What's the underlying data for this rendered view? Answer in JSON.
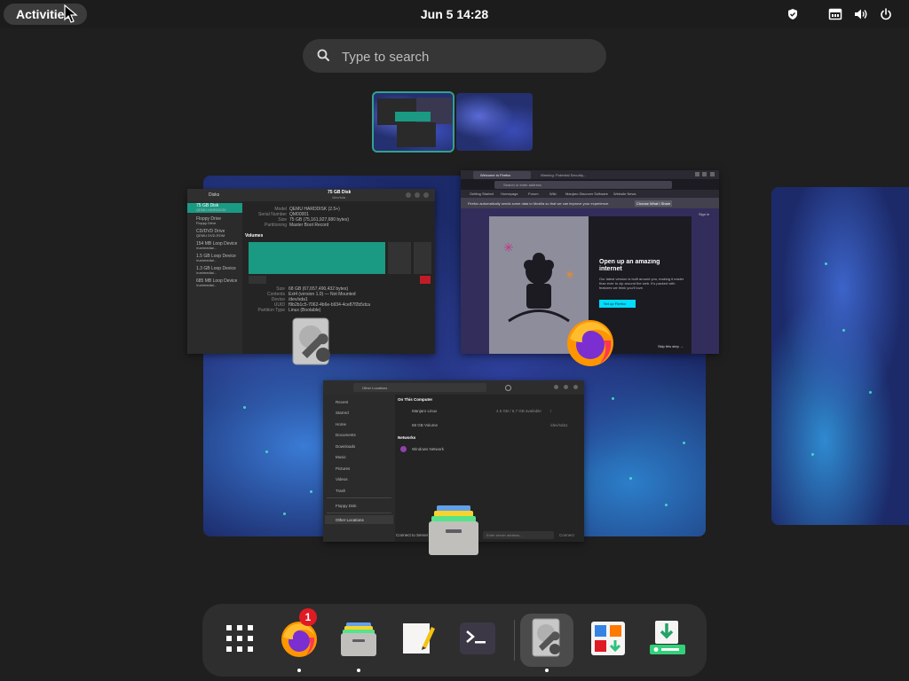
{
  "topbar": {
    "activities_label": "Activities",
    "clock": "Jun 5  14:28",
    "tray_icons": [
      "shield-icon",
      "network-wired-icon",
      "volume-icon",
      "power-icon"
    ]
  },
  "search": {
    "placeholder": "Type to search"
  },
  "workspaces": [
    {
      "active": true
    },
    {
      "active": false
    }
  ],
  "windows": {
    "disks": {
      "title": "75 GB Disk",
      "subtitle": "/dev/sda",
      "sidebar_title": "Disks",
      "sidebar": [
        {
          "name": "75 GB Disk",
          "sub": "QEMU HARDDISK"
        },
        {
          "name": "Floppy Drive",
          "sub": "Floppy Drive"
        },
        {
          "name": "CD/DVD Drive",
          "sub": "QEMU DVD-ROM"
        },
        {
          "name": "154 MB Loop Device",
          "sub": "/run/media/..."
        },
        {
          "name": "1.5 GB Loop Device",
          "sub": "/run/media/..."
        },
        {
          "name": "1.3 GB Loop Device",
          "sub": "/run/media/..."
        },
        {
          "name": "685 MB Loop Device",
          "sub": "/run/media/..."
        }
      ],
      "info": [
        {
          "k": "Model",
          "v": "QEMU HARDDISK (2.5+)"
        },
        {
          "k": "Serial Number",
          "v": "QM00001"
        },
        {
          "k": "Size",
          "v": "75 GB (75,161,927,680 bytes)"
        },
        {
          "k": "Partitioning",
          "v": "Master Boot Record"
        }
      ],
      "volumes_label": "Volumes",
      "details": [
        {
          "k": "Size",
          "v": "68 GB (67,657,490,432 bytes)"
        },
        {
          "k": "Contents",
          "v": "Ext4 (version 1.0) — Not Mounted"
        },
        {
          "k": "Device",
          "v": "/dev/sda1"
        },
        {
          "k": "UUID",
          "v": "f9b2b1c5-7062-4b6e-b934-4ce87f2b5dca"
        },
        {
          "k": "Partition Type",
          "v": "Linux (Bootable)"
        }
      ]
    },
    "firefox": {
      "tab1": "Welcome to Firefox",
      "tab2": "Warning: Potential Security...",
      "url_placeholder": "Search or enter address",
      "bookmarks": [
        "Getting Started",
        "Homepage",
        "Forum",
        "Wiki",
        "Manjaro Discover Software",
        "Website News"
      ],
      "notice": "Firefox automatically sends some data to Mozilla so that we can improve your experience.",
      "notice_button": "Choose What I Share",
      "signin": "Sign in",
      "heading": "Open up an amazing internet",
      "body": "Our latest version is built around you, making it easier than ever to zip around the web. It's packed with features we think you'll love.",
      "cta": "Set up Firefox",
      "skip": "Skip this step →"
    },
    "files": {
      "location": "Other Locations",
      "sidebar": [
        "Recent",
        "Starred",
        "Home",
        "Documents",
        "Downloads",
        "Music",
        "Pictures",
        "Videos",
        "Trash",
        "Floppy Disk",
        "Other Locations"
      ],
      "section_computer": "On This Computer",
      "items": [
        {
          "name": "Manjaro Linux",
          "size": "4.6 GB / 6.7 GB available",
          "path": "/"
        },
        {
          "name": "68 GB Volume",
          "size": "",
          "path": "/dev/sda1"
        }
      ],
      "section_networks": "Networks",
      "network": "Windows Network",
      "connect_label": "Connect to Server",
      "server_placeholder": "Enter server address...",
      "connect_button": "Connect"
    }
  },
  "dash": {
    "items": [
      {
        "name": "show-apps",
        "icon": "app-grid-icon",
        "running": false
      },
      {
        "name": "firefox",
        "icon": "firefox-icon",
        "running": true,
        "badge": "1"
      },
      {
        "name": "files",
        "icon": "files-icon",
        "running": true
      },
      {
        "name": "text-editor",
        "icon": "text-editor-icon",
        "running": false
      },
      {
        "name": "terminal",
        "icon": "terminal-icon",
        "running": false
      },
      {
        "name": "disks",
        "icon": "disks-icon",
        "running": true,
        "focused": true
      },
      {
        "name": "software",
        "icon": "software-icon",
        "running": false
      },
      {
        "name": "installer",
        "icon": "installer-icon",
        "running": false
      }
    ]
  },
  "colors": {
    "accent": "#1a9a83",
    "badge": "#e01b24",
    "firefox_cta": "#00ddff"
  }
}
